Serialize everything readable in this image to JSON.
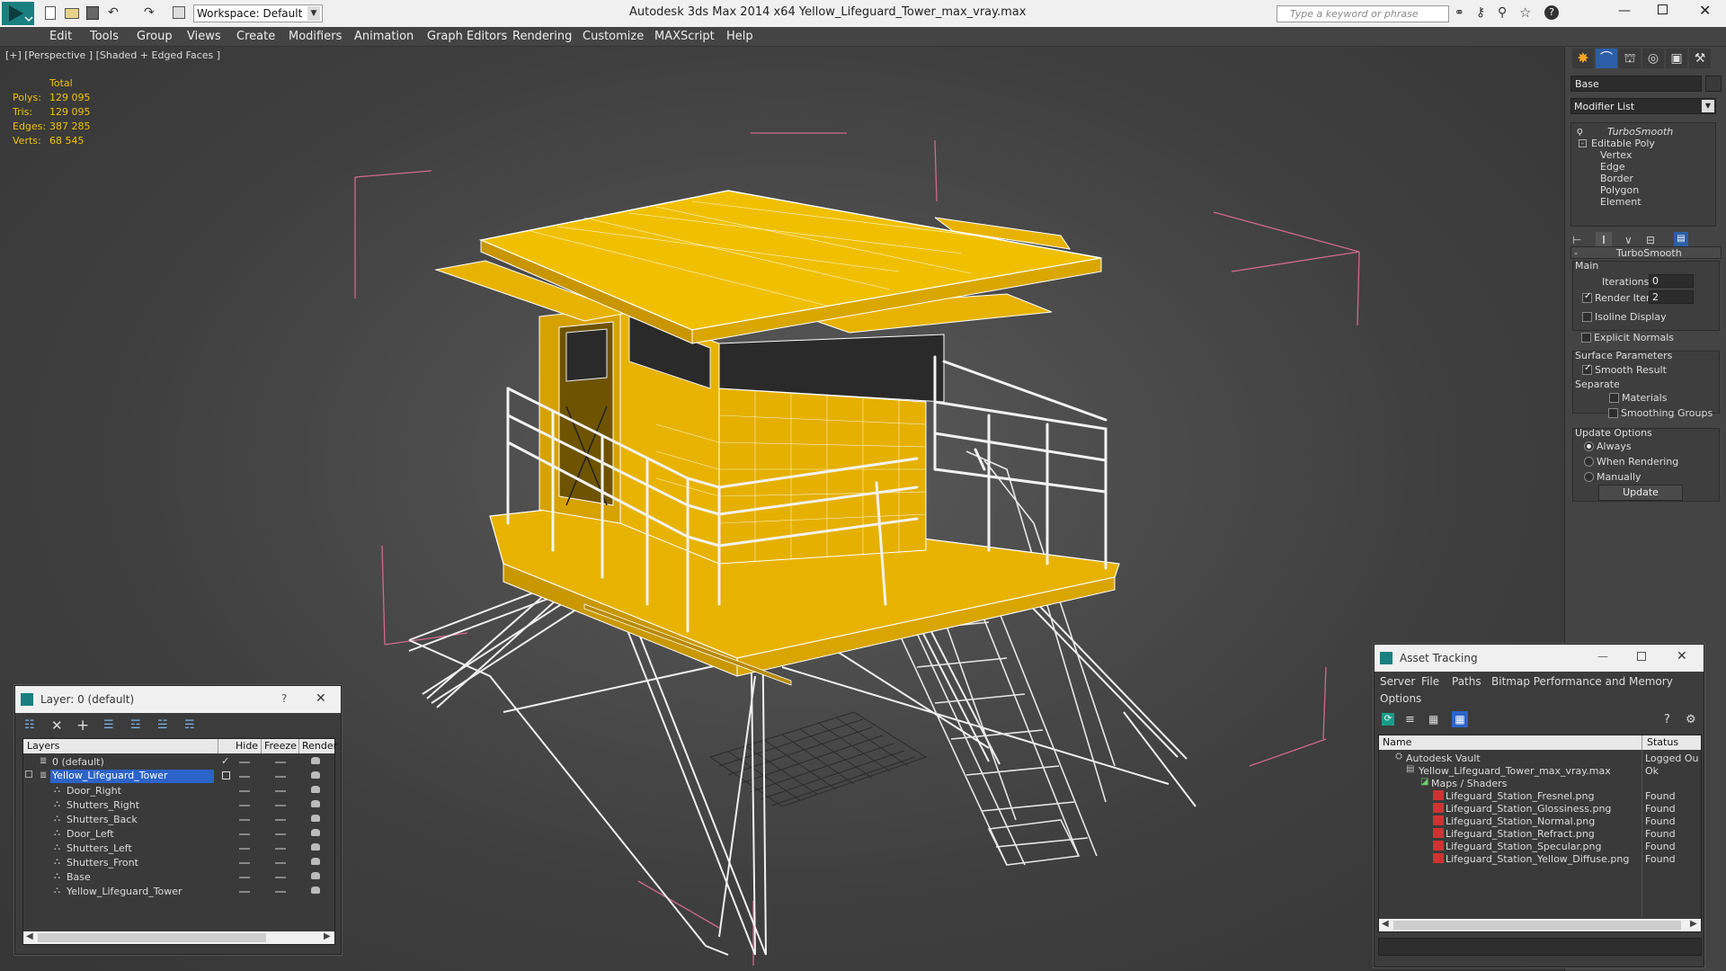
{
  "app": {
    "title": "Autodesk 3ds Max  2014 x64      Yellow_Lifeguard_Tower_max_vray.max",
    "workspace": "Workspace: Default",
    "search_placeholder": "Type a keyword or phrase"
  },
  "menu": [
    "Edit",
    "Tools",
    "Group",
    "Views",
    "Create",
    "Modifiers",
    "Animation",
    "Graph Editors",
    "Rendering",
    "Customize",
    "MAXScript",
    "Help"
  ],
  "viewport": {
    "label": "[+] [Perspective ] [Shaded + Edged Faces ]",
    "stats": {
      "header": "Total",
      "rows": [
        {
          "k": "Polys:",
          "v": "129 095"
        },
        {
          "k": "Tris:",
          "v": "129 095"
        },
        {
          "k": "Edges:",
          "v": "387 285"
        },
        {
          "k": "Verts:",
          "v": "68 545"
        }
      ]
    }
  },
  "cmd": {
    "object_name": "Base",
    "modifier_list": "Modifier List",
    "stack": [
      "TurboSmooth",
      "Editable Poly",
      "Vertex",
      "Edge",
      "Border",
      "Polygon",
      "Element"
    ],
    "rollout_title": "TurboSmooth",
    "main_label": "Main",
    "iterations_label": "Iterations:",
    "iterations_val": "0",
    "render_iters_label": "Render Iters:",
    "render_iters_val": "2",
    "isoline": "Isoline Display",
    "explicit": "Explicit Normals",
    "surface_label": "Surface Parameters",
    "smooth": "Smooth Result",
    "separate": "Separate",
    "materials": "Materials",
    "smoothing_groups": "Smoothing Groups",
    "update_options": "Update Options",
    "always": "Always",
    "when_rendering": "When Rendering",
    "manually": "Manually",
    "update_btn": "Update"
  },
  "layer": {
    "title": "Layer: 0 (default)",
    "help": "?",
    "close": "✕",
    "cols": {
      "layers": "Layers",
      "hide": "Hide",
      "freeze": "Freeze",
      "render": "Render"
    },
    "rows": [
      "0 (default)",
      "Yellow_Lifeguard_Tower",
      "Door_Right",
      "Shutters_Right",
      "Shutters_Back",
      "Door_Left",
      "Shutters_Left",
      "Shutters_Front",
      "Base",
      "Yellow_Lifeguard_Tower"
    ]
  },
  "asset": {
    "title": "Asset Tracking",
    "menu": [
      "Server",
      "File",
      "Paths",
      "Bitmap Performance and Memory",
      "Options"
    ],
    "cols": {
      "name": "Name",
      "status": "Status"
    },
    "rows": [
      {
        "name": "Autodesk Vault",
        "status": "Logged Ou"
      },
      {
        "name": "Yellow_Lifeguard_Tower_max_vray.max",
        "status": "Ok"
      },
      {
        "name": "Maps / Shaders",
        "status": ""
      },
      {
        "name": "Lifeguard_Station_Fresnel.png",
        "status": "Found"
      },
      {
        "name": "Lifeguard_Station_Glossiness.png",
        "status": "Found"
      },
      {
        "name": "Lifeguard_Station_Normal.png",
        "status": "Found"
      },
      {
        "name": "Lifeguard_Station_Refract.png",
        "status": "Found"
      },
      {
        "name": "Lifeguard_Station_Specular.png",
        "status": "Found"
      },
      {
        "name": "Lifeguard_Station_Yellow_Diffuse.png",
        "status": "Found"
      }
    ]
  },
  "colors": {
    "yellow": "#e8b300",
    "selection": "#4a6fc4",
    "bbox": "#d06a8a"
  }
}
